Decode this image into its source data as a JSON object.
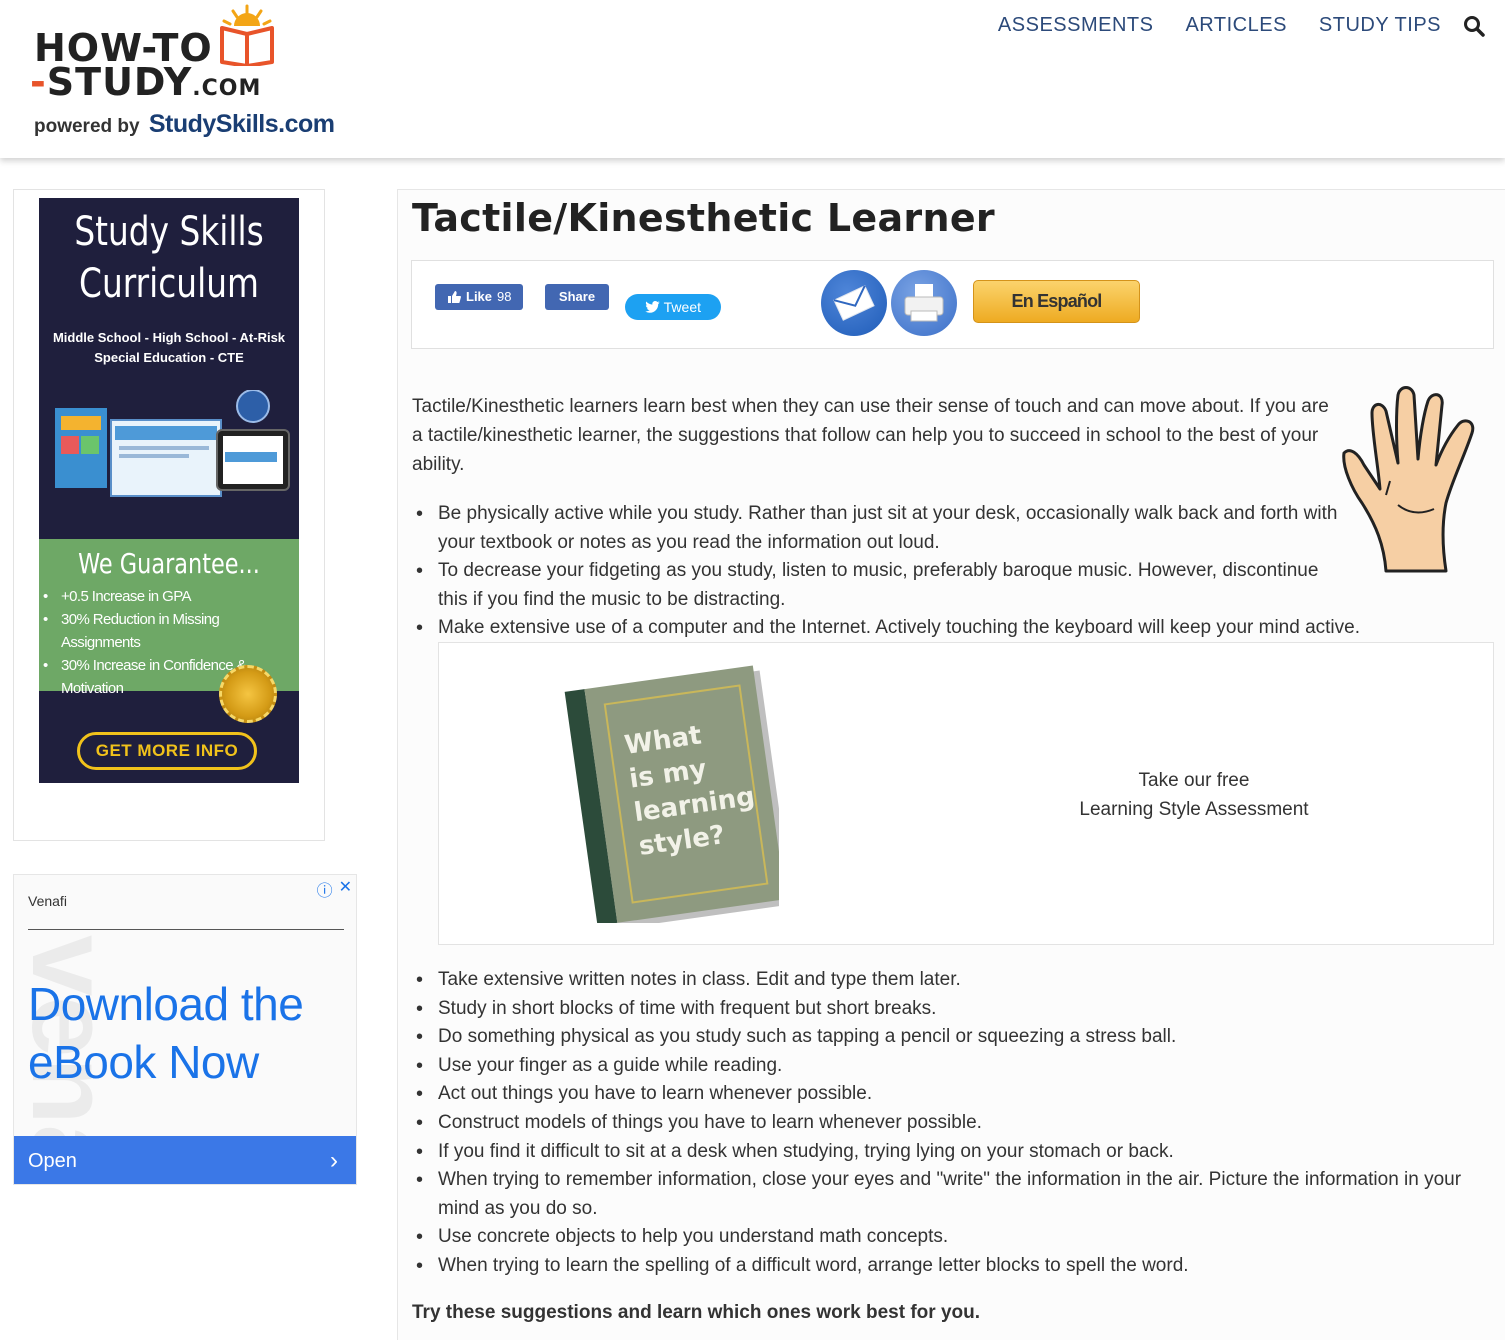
{
  "header": {
    "logo": {
      "line1": "HOW-TO",
      "line2_dash": "-",
      "line2": "STUDY",
      "line2_com": ".COM",
      "powered_by": "powered by",
      "brand": "StudySkills.com"
    },
    "nav": [
      "ASSESSMENTS",
      "ARTICLES",
      "STUDY TIPS"
    ]
  },
  "sidebar": {
    "promo": {
      "title_line1": "Study Skills",
      "title_line2": "Curriculum",
      "subtitle_line1": "Middle School - High School - At-Risk",
      "subtitle_line2": "Special Education - CTE",
      "guarantee_title": "We Guarantee...",
      "guarantees": [
        "+0.5 Increase in GPA",
        "30% Reduction in Missing Assignments",
        "30% Increase in Confidence & Motivation"
      ],
      "button": "GET MORE INFO"
    },
    "ad": {
      "advertiser": "Venafi",
      "headline": "Download the eBook Now",
      "cta": "Open",
      "chevron": "›"
    }
  },
  "main": {
    "title": "Tactile/Kinesthetic Learner",
    "share": {
      "like": "Like",
      "like_count": "98",
      "share": "Share",
      "tweet": "Tweet",
      "espanol": "En Español"
    },
    "intro": "Tactile/Kinesthetic learners learn best when they can use their sense of touch and can move about. If you are a tactile/kinesthetic learner, the suggestions that follow can help you to succeed in school to the best of your ability.",
    "tips_part1": [
      "Be physically active while you study. Rather than just sit at your desk, occasionally walk back and forth with your textbook or notes as you read the information out loud.",
      "To decrease your fidgeting as you study, listen to music, preferably baroque music. However, discontinue this if you find the music to be distracting.",
      "Make extensive use of a computer and the Internet. Actively touching the keyboard will keep your mind active."
    ],
    "assessment": {
      "book_text": [
        "What",
        "is my",
        "learning",
        "style?"
      ],
      "line1": "Take our free",
      "line2": "Learning Style Assessment"
    },
    "tips_part2": [
      "Take extensive written notes in class. Edit and type them later.",
      "Study in short blocks of time with frequent but short breaks.",
      "Do something physical as you study such as tapping a pencil or squeezing a stress ball.",
      "Use your finger as a guide while reading.",
      "Act out things you have to learn whenever possible.",
      "Construct models of things you have to learn whenever possible.",
      "If you find it difficult to sit at a desk when studying, trying lying on your stomach or back.",
      "When trying to remember information, close your eyes and \"write\" the information in the air. Picture the information in your mind as you do so.",
      "Use concrete objects to help you understand math concepts.",
      "When trying to learn the spelling of a difficult word, arrange letter blocks to spell the word."
    ],
    "closing": "Try these suggestions and learn which ones work best for you."
  },
  "icons": [
    "search-icon",
    "book-logo-icon",
    "thumbs-up-icon",
    "twitter-bird-icon",
    "email-icon",
    "print-icon",
    "ad-info-icon",
    "ad-close-icon",
    "chevron-right-icon",
    "hand-image"
  ],
  "colors": {
    "nav": "#2c4a7a",
    "logo_accent": "#e8542a",
    "facebook": "#4267b2",
    "twitter": "#1da1f2",
    "promo_bg": "#1f1f3d",
    "promo_green": "#6ea866",
    "ad_blue": "#1a73e8",
    "espanol": "#eeab22"
  }
}
